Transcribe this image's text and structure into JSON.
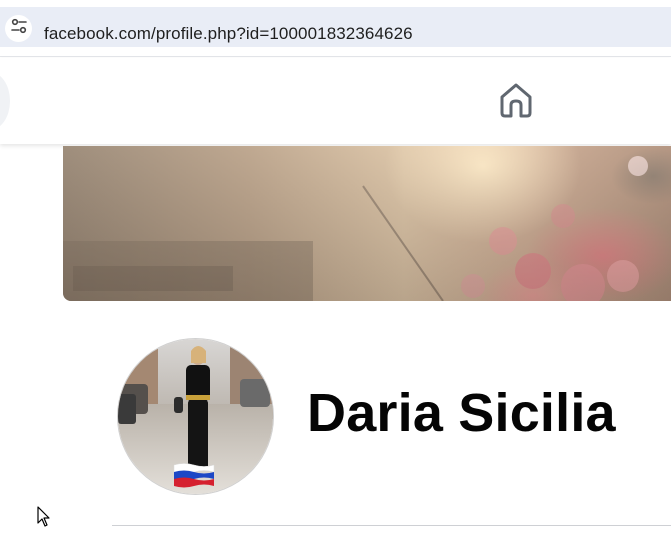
{
  "browser": {
    "url": "facebook.com/profile.php?id=100001832364626",
    "site_info_icon": "tune-icon"
  },
  "nav": {
    "home_icon": "home-icon"
  },
  "profile": {
    "name": "Daria Sicilia",
    "cover_photo": "sunlit street with pink flowers",
    "avatar_photo": "woman standing on cobblestone street with Russian flag"
  },
  "colors": {
    "address_bar": "#e9edf6",
    "text_primary": "#050505",
    "divider": "#ced0d4"
  }
}
